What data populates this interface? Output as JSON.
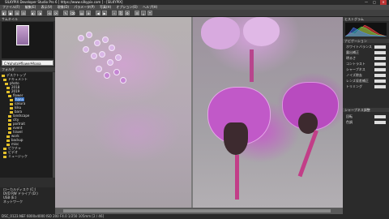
{
  "window": {
    "title": "SILKYPIX Developer Studio Pro 6 [ https://www.silkypix.com ] - [SILKYPIX]",
    "min": "—",
    "max": "□",
    "close": "✕"
  },
  "menu": [
    "ファイル(F)",
    "編集(E)",
    "表示(V)",
    "現像(D)",
    "パラメータ(P)",
    "写真(H)",
    "オプション(O)",
    "ヘルプ(H)"
  ],
  "toolbar": {
    "buttons": [
      "◧",
      "▣",
      "⊞",
      "⊟",
      "◐",
      "◑",
      "⟲",
      "⟳",
      "✎",
      "⌫",
      "▤",
      "⊕",
      "◀",
      "▶",
      "✧",
      "⎘",
      "⚙",
      "☰",
      "⤓",
      "⤒"
    ]
  },
  "left": {
    "header": "サムネイル",
    "path": "C:¥photo¥flower¥hana",
    "tree_header": "フォルダ",
    "tree": [
      {
        "label": "デスクトップ",
        "sel": false
      },
      {
        "label": "ドキュメント",
        "sel": false
      },
      {
        "label": "photo",
        "sel": false
      },
      {
        "label": "2018",
        "sel": false
      },
      {
        "label": "2019",
        "sel": false
      },
      {
        "label": "flower",
        "sel": false
      },
      {
        "label": "hana",
        "sel": true
      },
      {
        "label": "sakura",
        "sel": false
      },
      {
        "label": "kiku",
        "sel": false
      },
      {
        "label": "bara",
        "sel": false
      },
      {
        "label": "landscape",
        "sel": false
      },
      {
        "label": "city",
        "sel": false
      },
      {
        "label": "portrait",
        "sel": false
      },
      {
        "label": "event",
        "sel": false
      },
      {
        "label": "travel",
        "sel": false
      },
      {
        "label": "work",
        "sel": false
      },
      {
        "label": "backup",
        "sel": false
      },
      {
        "label": "misc",
        "sel": false
      },
      {
        "label": "ピクチャ",
        "sel": false
      },
      {
        "label": "ビデオ",
        "sel": false
      },
      {
        "label": "ミュージック",
        "sel": false
      }
    ],
    "footer": [
      "ローカルディスク (C:)",
      "DVD RW ドライブ (D:)",
      "USB (E:)",
      "ネットワーク"
    ]
  },
  "right": {
    "header": "ヒストグラム",
    "rows": [
      "ホワイトバランス",
      "露出補正",
      "明るさ",
      "コントラスト",
      "シャープネス",
      "ノイズ除去",
      "レンズ収差補正",
      "トリミング",
      "回転",
      "色調"
    ],
    "sec1": "ナビゲーション",
    "sec2": "シャープネス調整"
  },
  "status": {
    "text": "DSC_0123.NEF  6000x4000  ISO 200  F4.0  1/250  105mm  [2 / 46]"
  }
}
